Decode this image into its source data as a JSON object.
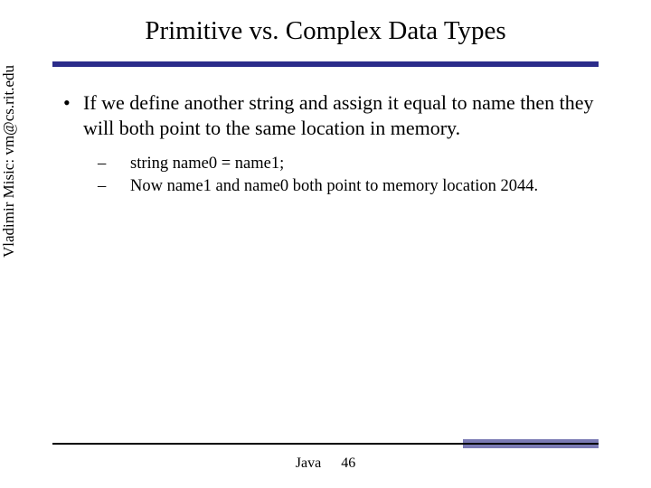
{
  "title": "Primitive vs. Complex Data Types",
  "bullet": {
    "mark": "•",
    "text": "If we define another string and assign it equal to name then they will both point to the same location in memory."
  },
  "sub": [
    {
      "mark": "–",
      "text": "string name0 = name1;"
    },
    {
      "mark": "–",
      "text": "Now name1 and name0 both point to memory location 2044."
    }
  ],
  "sidebar": "Vladimir Misic: vm@cs.rit.edu",
  "footer": {
    "label": "Java",
    "page": "46"
  }
}
